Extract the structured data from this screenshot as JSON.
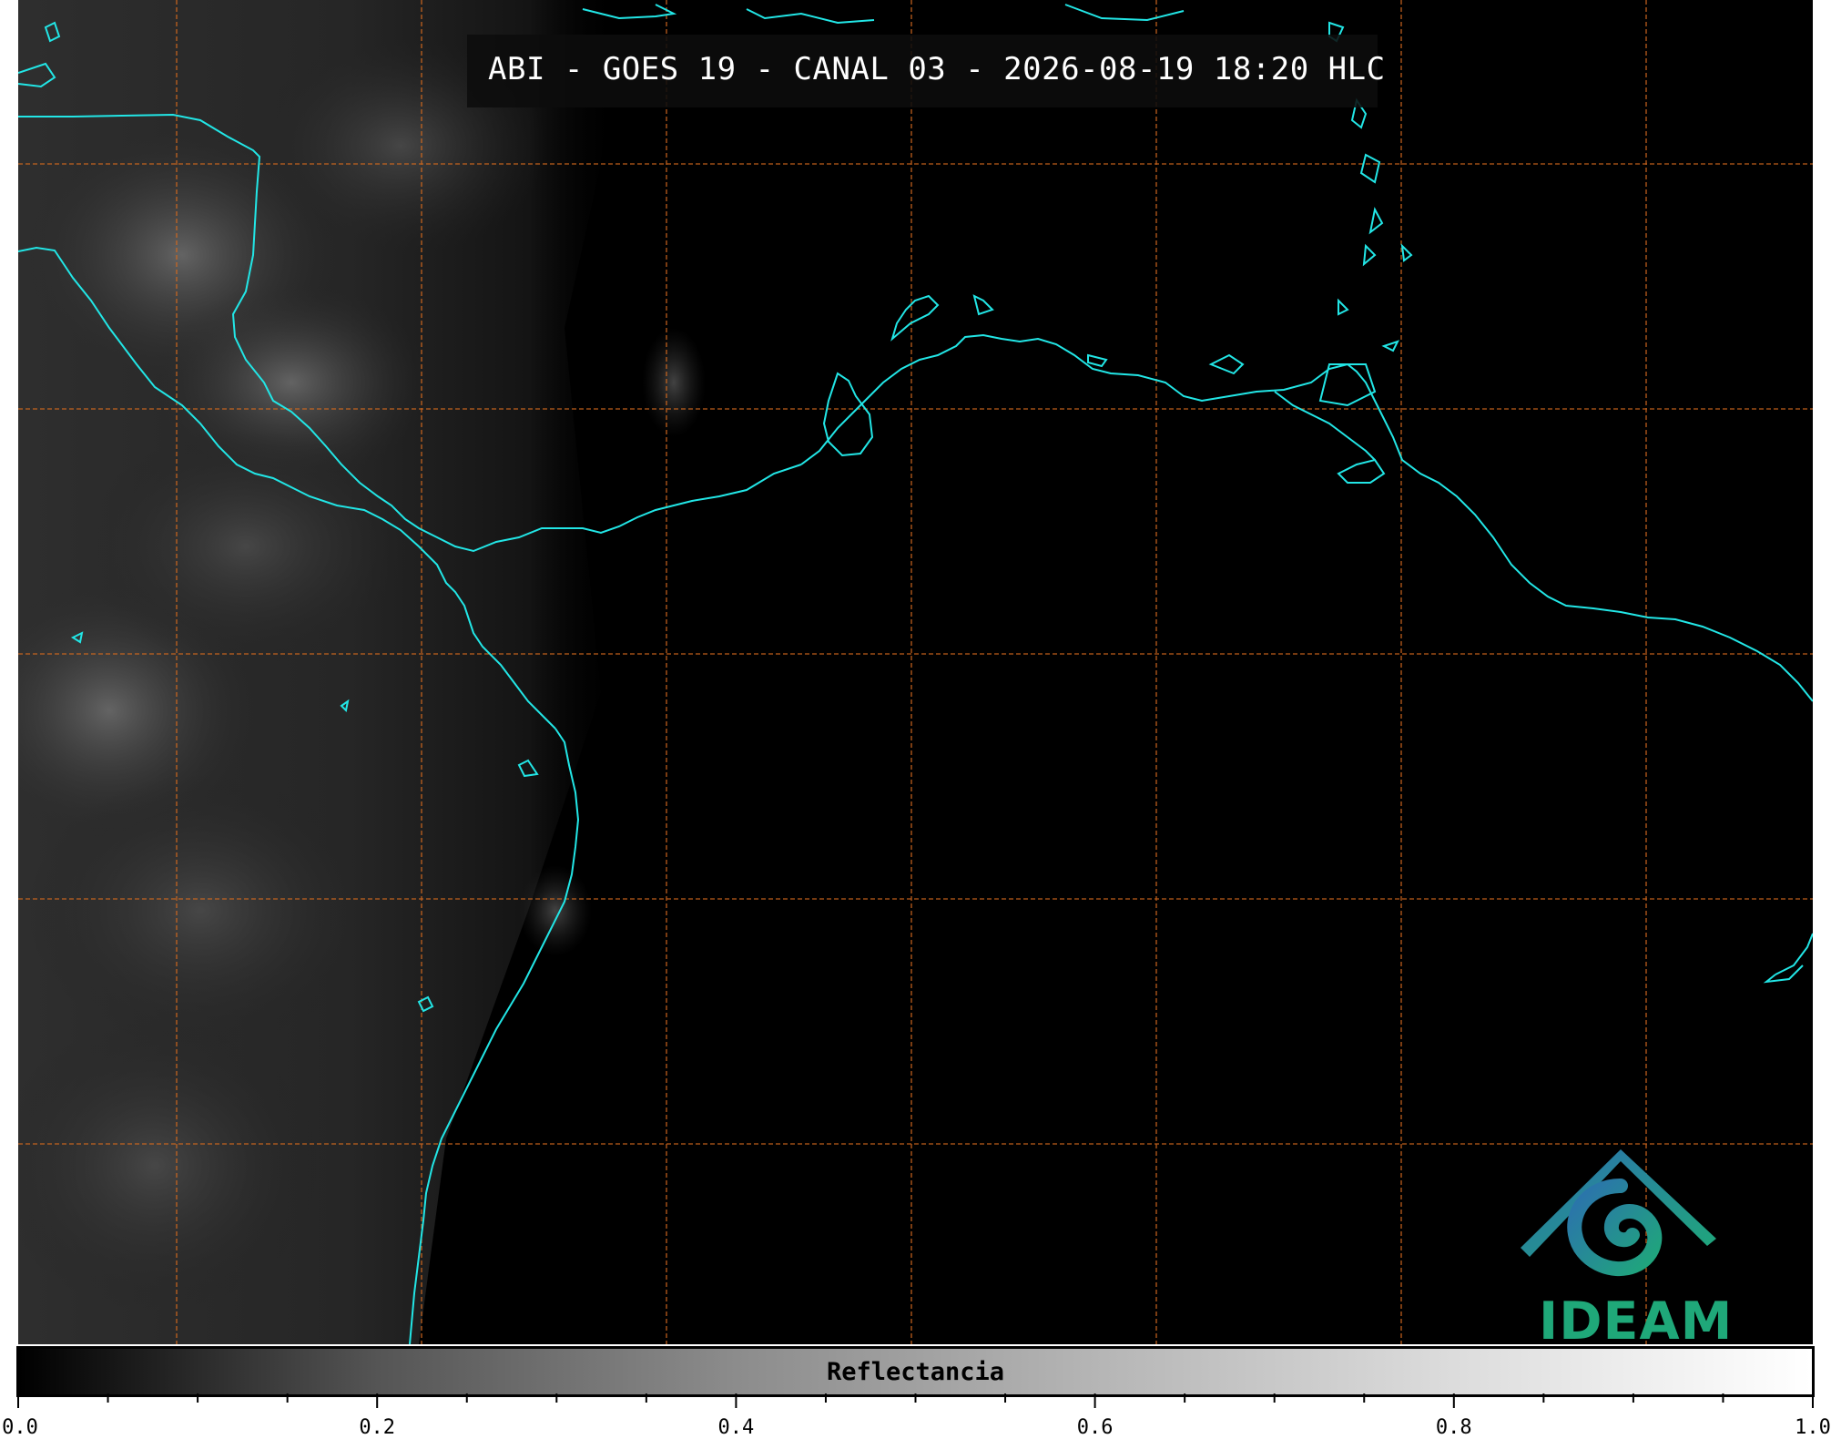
{
  "map": {
    "title": "ABI - GOES 19 - CANAL 03 - 2026-08-19 18:20 HLC",
    "coastline_color": "#22e6e6",
    "gridline_color": "#d2691e",
    "background": "#000000"
  },
  "logo": {
    "text": "IDEAM",
    "colors": [
      "#2c6fb0",
      "#1fa879"
    ]
  },
  "colorbar": {
    "label": "Reflectancia",
    "min": 0.0,
    "max": 1.0,
    "tick_labels": [
      "0.0",
      "0.2",
      "0.4",
      "0.6",
      "0.8",
      "1.0"
    ],
    "tick_values": [
      0.0,
      0.2,
      0.4,
      0.6,
      0.8,
      1.0
    ],
    "minor_ticks": 20
  }
}
